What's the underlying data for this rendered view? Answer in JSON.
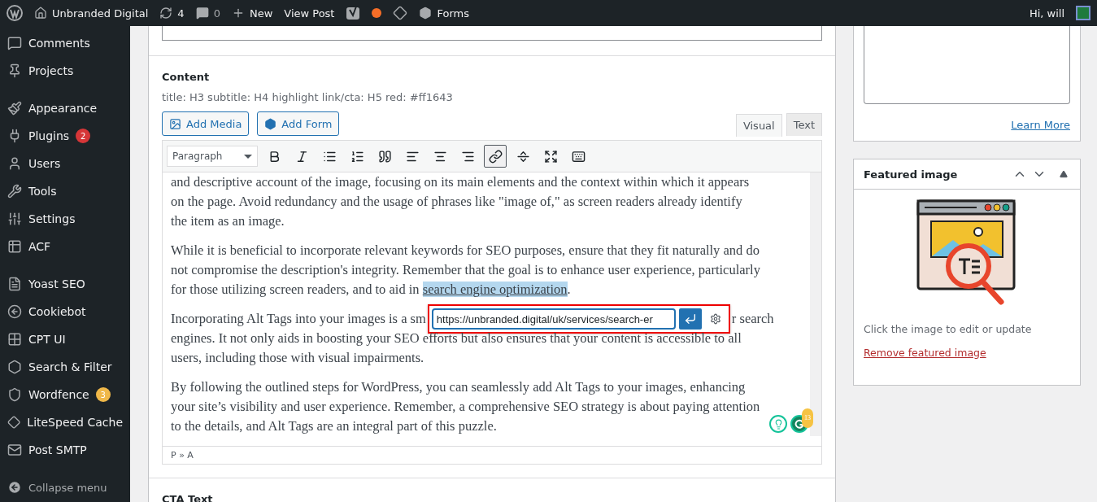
{
  "admin_bar": {
    "site": "Unbranded Digital",
    "updates": "4",
    "comments": "0",
    "new": "New",
    "view_post": "View Post",
    "forms": "Forms",
    "greeting": "Hi, will"
  },
  "sidebar": {
    "groups": [
      {
        "items": [
          {
            "label": "Comments"
          },
          {
            "label": "Projects"
          }
        ]
      },
      {
        "items": [
          {
            "label": "Appearance"
          },
          {
            "label": "Plugins",
            "badge": "2",
            "color": "#d63638"
          },
          {
            "label": "Users"
          },
          {
            "label": "Tools"
          },
          {
            "label": "Settings"
          },
          {
            "label": "ACF"
          }
        ]
      },
      {
        "items": [
          {
            "label": "Yoast SEO"
          },
          {
            "label": "Cookiebot"
          },
          {
            "label": "CPT UI"
          },
          {
            "label": "Search & Filter"
          },
          {
            "label": "Wordfence",
            "badge": "3",
            "color": "#f0b849"
          },
          {
            "label": "LiteSpeed Cache"
          },
          {
            "label": "Post SMTP"
          }
        ]
      }
    ],
    "collapse": "Collapse menu"
  },
  "content": {
    "label": "Content",
    "description": "title: H3 subtitle: H4 highlight link/cta: H5 red: #ff1643",
    "buttons": [
      "Add Media",
      "Add Form"
    ],
    "tabs": [
      {
        "label": "Visual",
        "selected": true
      },
      {
        "label": "Text",
        "selected": false
      }
    ],
    "format_select": "Paragraph",
    "toolbar": [
      {
        "active": false
      },
      {
        "active": false
      },
      {
        "active": false
      },
      {
        "active": false
      },
      {
        "active": false
      },
      {
        "active": false
      },
      {
        "active": false
      },
      {
        "active": false
      },
      {
        "active": true
      },
      {
        "active": false
      },
      {
        "active": false
      },
      {
        "active": false
      }
    ],
    "paragraphs": [
      {
        "kind": "plain",
        "text": "and descriptive account of the image, focusing on its main elements and the context within which it appears on the page. Avoid redundancy and the usage of phrases like \"image of,\" as screen readers already identify the item as an image."
      },
      {
        "kind": "link",
        "before": "While it is beneficial to incorporate relevant keywords for SEO purposes, ensure that they fit naturally and do not compromise the description's integrity. Remember that the goal is to enhance user experience, particularly for those utilizing screen readers, and to aid in ",
        "link": "search engine optimization",
        "after": "."
      },
      {
        "kind": "popup",
        "before": "Incorporating Alt Tags into your images is a sm",
        "url": "https://unbranded.digital/uk/services/search-er",
        "after": "r search",
        "rest": "engines. It not only aids in boosting your SEO efforts but also ensures that your content is accessible to all users, including those with visual impairments."
      },
      {
        "kind": "plain",
        "text": "By following the outlined steps for WordPress, you can seamlessly add Alt Tags to your images, enhancing your site’s visibility and user experience. Remember, a comprehensive SEO strategy is about paying attention to the details, and Alt Tags are an integral part of this puzzle."
      }
    ],
    "path": "P » A",
    "grammarly_count": "13"
  },
  "next_field": "CTA Text",
  "learn_more": "Learn More",
  "featured_image": {
    "title": "Featured image",
    "hint": "Click the image to edit or update",
    "remove": "Remove featured image"
  }
}
